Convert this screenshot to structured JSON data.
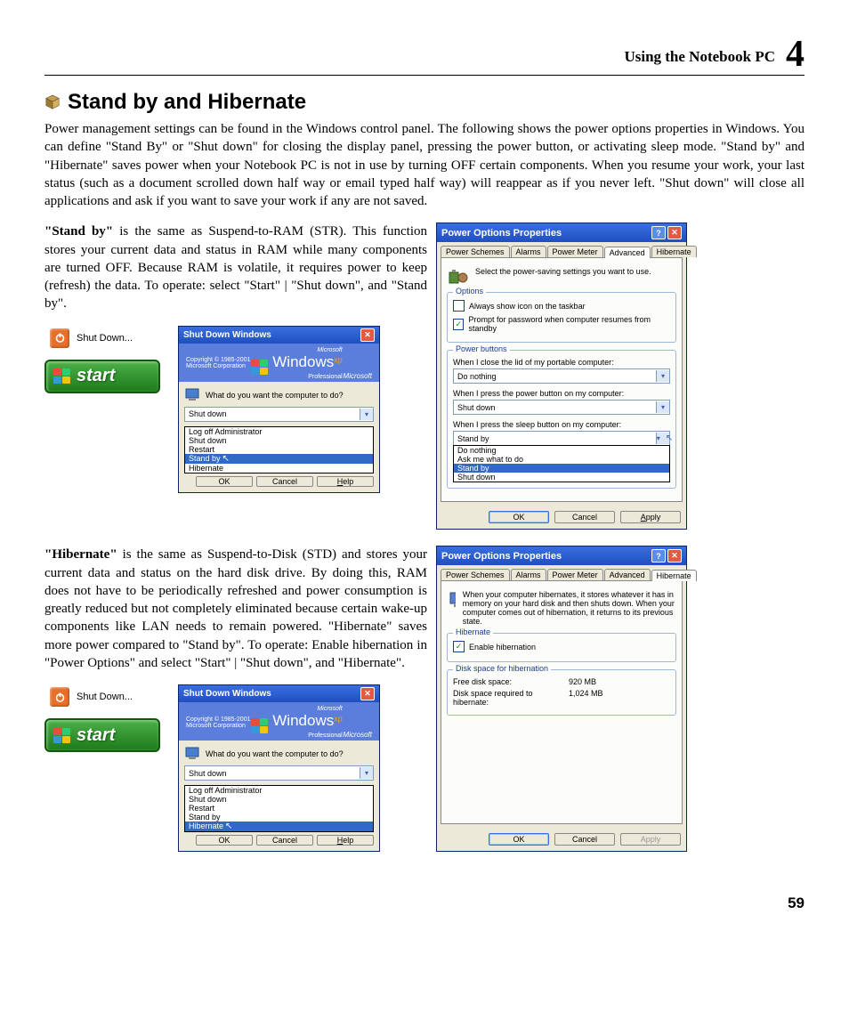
{
  "header": {
    "title": "Using the Notebook PC",
    "chapter": "4"
  },
  "section_title": "Stand by and Hibernate",
  "intro": "Power management settings can be found in the Windows control panel. The following shows the power options properties in Windows. You can define \"Stand By\" or \"Shut down\" for closing the display panel, pressing the power button, or activating sleep mode. \"Stand by\" and \"Hibernate\" saves power when your Notebook PC is not in use by turning OFF certain components. When you resume your work, your last status (such as a document scrolled down half way or email typed half way) will reappear as if you never left. \"Shut down\" will close all applications and ask if you want to save your work if any are not saved.",
  "standby": {
    "bold": "\"Stand by\"",
    "text": " is the same as Suspend-to-RAM (STR). This function stores your current data and status in RAM while many components are turned OFF. Because RAM is volatile, it requires power to keep (refresh) the data. To operate: select \"Start\" | \"Shut down\", and \"Stand by\"."
  },
  "hibernate": {
    "bold": "\"Hibernate\"",
    "text": " is the same as  Suspend-to-Disk (STD) and stores your current data and status on the hard disk drive. By doing this, RAM does not have to be periodically refreshed and power consumption is greatly reduced but not completely eliminated because certain wake-up components like LAN needs to remain powered. \"Hibernate\" saves more power compared to \"Stand by\". To operate: Enable hibernation in \"Power Options\" and select \"Start\" | \"Shut down\", and \"Hibernate\"."
  },
  "shutdown_label": "Shut Down...",
  "start_label": "start",
  "shutdown_dialog": {
    "title": "Shut Down Windows",
    "copyright": "Copyright © 1985-2001",
    "corp": "Microsoft Corporation",
    "brand": "Windows",
    "edition": "Professional",
    "ms": "Microsoft",
    "xp": "xp",
    "question": "What do you want the computer to do?",
    "value": "Shut down",
    "options1": [
      "Log off Administrator",
      "Shut down",
      "Restart",
      "Stand by",
      "Hibernate"
    ],
    "highlight1": "Stand by",
    "highlight2": "Hibernate",
    "ok": "OK",
    "cancel": "Cancel",
    "help": "Help"
  },
  "power_adv": {
    "title": "Power Options Properties",
    "tabs": [
      "Power Schemes",
      "Alarms",
      "Power Meter",
      "Advanced",
      "Hibernate"
    ],
    "active_tab": "Advanced",
    "desc": "Select the power-saving settings you want to use.",
    "grp_options": "Options",
    "cb1": "Always show icon on the taskbar",
    "cb2": "Prompt for password when computer resumes from standby",
    "grp_buttons": "Power buttons",
    "q_lid": "When I close the lid of my portable computer:",
    "v_lid": "Do nothing",
    "q_power": "When I press the power button on my computer:",
    "v_power": "Shut down",
    "q_sleep": "When I press the sleep button on my computer:",
    "v_sleep": "Stand by",
    "sleep_options": [
      "Do nothing",
      "Ask me what to do",
      "Stand by",
      "Shut down"
    ],
    "highlight": "Stand by",
    "ok": "OK",
    "cancel": "Cancel",
    "apply": "Apply"
  },
  "power_hib": {
    "title": "Power Options Properties",
    "active_tab": "Hibernate",
    "desc": "When your computer hibernates, it stores whatever it has in memory on your hard disk and then shuts down. When your computer comes out of hibernation, it returns to its previous state.",
    "grp_hib": "Hibernate",
    "cb": "Enable hibernation",
    "grp_disk": "Disk space for hibernation",
    "free_label": "Free disk space:",
    "free_val": "920 MB",
    "req_label": "Disk space required to hibernate:",
    "req_val": "1,024 MB",
    "ok": "OK",
    "cancel": "Cancel",
    "apply": "Apply"
  },
  "page": "59"
}
